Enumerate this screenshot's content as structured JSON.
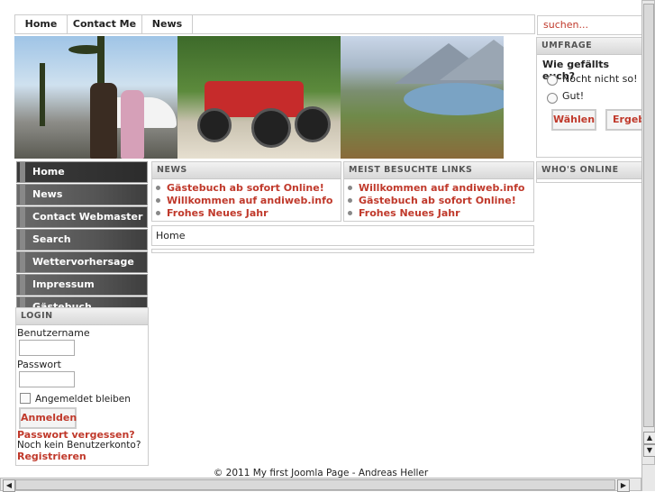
{
  "nav": {
    "items": [
      "Home",
      "Contact Me",
      "News"
    ]
  },
  "search": {
    "placeholder": "suchen..."
  },
  "poll": {
    "header": "UMFRAGE",
    "question": "Wie gefällts euch?",
    "options": [
      "Nocht nicht so!",
      "Gut!"
    ],
    "vote_label": "Wählen",
    "results_label": "Ergebni"
  },
  "whos_online": {
    "header": "WHO'S ONLINE"
  },
  "menu": {
    "items": [
      "Home",
      "News",
      "Contact Webmaster",
      "Search",
      "Wettervorhersage BW",
      "Impressum",
      "Gästebuch"
    ]
  },
  "login": {
    "header": "LOGIN",
    "username_label": "Benutzername",
    "password_label": "Passwort",
    "remember_label": "Angemeldet bleiben",
    "submit_label": "Anmelden",
    "forgot_label": "Passwort vergessen?",
    "no_account_label": "Noch kein Benutzerkonto?",
    "register_label": "Registrieren"
  },
  "news": {
    "header": "NEWS",
    "links": [
      "Gästebuch ab sofort Online!",
      "Willkommen auf andiweb.info",
      "Frohes Neues Jahr"
    ]
  },
  "popular": {
    "header": "MEIST BESUCHTE LINKS",
    "links": [
      "Willkommen auf andiweb.info",
      "Gästebuch ab sofort Online!",
      "Frohes Neues Jahr"
    ]
  },
  "breadcrumb": {
    "text": "Home"
  },
  "footer": {
    "text": "© 2011 My first Joomla Page - Andreas Heller"
  },
  "colors": {
    "link_red": "#c0392b",
    "menu_gray": "#555555"
  }
}
